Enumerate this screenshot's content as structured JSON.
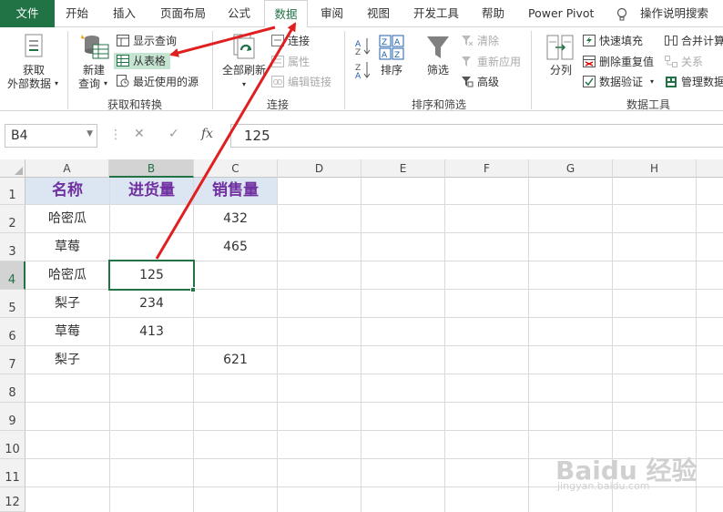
{
  "menu": {
    "file": "文件",
    "tabs": [
      "开始",
      "插入",
      "页面布局",
      "公式",
      "数据",
      "审阅",
      "视图",
      "开发工具",
      "帮助",
      "Power Pivot"
    ],
    "active_tab": "数据",
    "tell_me": "操作说明搜索"
  },
  "ribbon": {
    "get_external": {
      "line1": "获取",
      "line2": "外部数据"
    },
    "new_query": {
      "line1": "新建",
      "line2": "查询"
    },
    "show_queries": "显示查询",
    "from_table": "从表格",
    "recent_sources": "最近使用的源",
    "group_get_transform": "获取和转换",
    "refresh_all": "全部刷新",
    "connections": "连接",
    "properties": "属性",
    "edit_links": "编辑链接",
    "group_connections": "连接",
    "sort": "排序",
    "filter": "筛选",
    "clear": "清除",
    "reapply": "重新应用",
    "advanced": "高级",
    "group_sort_filter": "排序和筛选",
    "text_to_columns": "分列",
    "flash_fill": "快速填充",
    "remove_duplicates": "删除重复值",
    "data_validation": "数据验证",
    "consolidate": "合并计算",
    "relationships": "关系",
    "manage_data_model": "管理数据",
    "group_data_tools": "数据工具"
  },
  "formula_bar": {
    "name_box": "B4",
    "cancel": "✕",
    "enter": "✓",
    "fx": "fx",
    "value": "125"
  },
  "sheet": {
    "columns": [
      "A",
      "B",
      "C",
      "D",
      "E",
      "F",
      "G",
      "H"
    ],
    "rows": [
      "1",
      "2",
      "3",
      "4",
      "5",
      "6",
      "7",
      "8",
      "9",
      "10",
      "11",
      "12"
    ],
    "header_row": [
      "名称",
      "进货量",
      "销售量"
    ],
    "data": [
      [
        "哈密瓜",
        "",
        "432"
      ],
      [
        "草莓",
        "",
        "465"
      ],
      [
        "哈密瓜",
        "125",
        ""
      ],
      [
        "梨子",
        "234",
        ""
      ],
      [
        "草莓",
        "413",
        ""
      ],
      [
        "梨子",
        "",
        "621"
      ]
    ]
  },
  "watermark": {
    "logo": "Baidu 经验",
    "url": "jingyan.baidu.com"
  },
  "colors": {
    "excel_green": "#217346",
    "header_fill": "#dce6f2",
    "header_text": "#7030a0",
    "annotation_red": "#e02020"
  }
}
